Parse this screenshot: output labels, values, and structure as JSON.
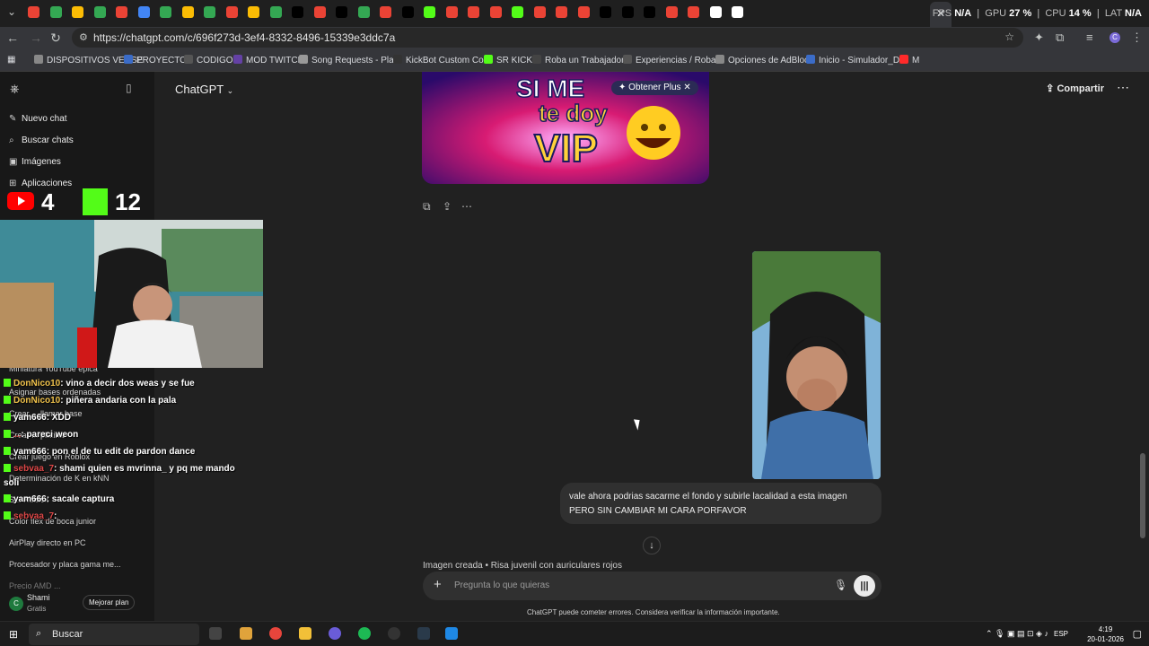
{
  "browser": {
    "url": "https://chatgpt.com/c/696f273d-3ef4-8332-8496-15339e3ddc7a",
    "perf": {
      "fps_label": "FPS",
      "fps_value": "N/A",
      "gpu_label": "GPU",
      "gpu_value": "27 %",
      "cpu_label": "CPU",
      "cpu_value": "14 %",
      "lat_label": "LAT",
      "lat_value": "N/A"
    },
    "bookmarks": [
      "DISPOSITIVOS VERSE",
      "PROYECTOS",
      "CODIGO",
      "MOD TWITCH",
      "Song Requests - Pla...",
      "KickBot Custom Co...",
      "SR KICK",
      "Roba un Trabajador...",
      "Experiencias / Roba...",
      "Opciones de AdBlock",
      "Inicio - Simulador_D...",
      "M"
    ]
  },
  "sidebar": {
    "items": [
      {
        "label": "Nuevo chat",
        "icon": "edit-icon"
      },
      {
        "label": "Buscar chats",
        "icon": "search-icon"
      },
      {
        "label": "Imágenes",
        "icon": "image-icon"
      },
      {
        "label": "Aplicaciones",
        "icon": "apps-icon"
      }
    ],
    "history": [
      "Miniatura YouTube épica",
      "Asignar bases ordenadas",
      "Crear ... llamar base",
      "Crear ... platina",
      "Crear juego en Roblox",
      "Determinación de K en kNN",
      "S... Roblox",
      "Color flex de boca junior",
      "AirPlay directo en PC",
      "Procesador y placa gama me...",
      "Precio AMD ..."
    ],
    "user": {
      "name": "Shami",
      "plan": "Gratis",
      "initial": "C",
      "upgrade": "Mejorar plan"
    }
  },
  "stream": {
    "yt_count": "4",
    "kick_count": "12",
    "chat": [
      {
        "user": "DonNico10",
        "msg": ": vino a decir dos weas y se fue",
        "color": "u"
      },
      {
        "user": "DonNico10",
        "msg": ": piñera andaria con la pala",
        "color": "u"
      },
      {
        "user": "yam666",
        "msg": ": XDD",
        "color": "plain"
      },
      {
        "user": "...",
        "msg": ": pareci weon",
        "color": "u2"
      },
      {
        "user": "yam666",
        "msg": ": pon el de tu edit de pardon dance",
        "color": "plain"
      },
      {
        "user": "sebvaa_7",
        "msg": ": shami quien es mvrinna_ y pq me mando",
        "color": "u2"
      },
      {
        "user": "",
        "msg": "soli",
        "color": "plain"
      },
      {
        "user": "yam666",
        "msg": ": sacale captura",
        "color": "plain"
      },
      {
        "user": "sebvaa_7",
        "msg": ":",
        "color": "u2"
      }
    ]
  },
  "main": {
    "model": "ChatGPT",
    "share": "Compartir",
    "promo_text_1": "SI ME",
    "promo_text_2": "te doy",
    "promo_text_3": "VIP",
    "obtener_plus": "Obtener Plus",
    "user_message": "vale ahora podrias sacarme el fondo y subirle lacalidad a esta imagen PERO SIN CAMBIAR MI CARA PORFAVOR",
    "image_caption": "Imagen creada • Risa juvenil con auriculares rojos",
    "composer_placeholder": "Pregunta lo que quieras",
    "disclaimer": "ChatGPT puede cometer errores. Considera verificar la información importante."
  },
  "taskbar": {
    "search": "Buscar",
    "lang": "ESP",
    "time": "4:19",
    "date": "20-01-2026"
  }
}
